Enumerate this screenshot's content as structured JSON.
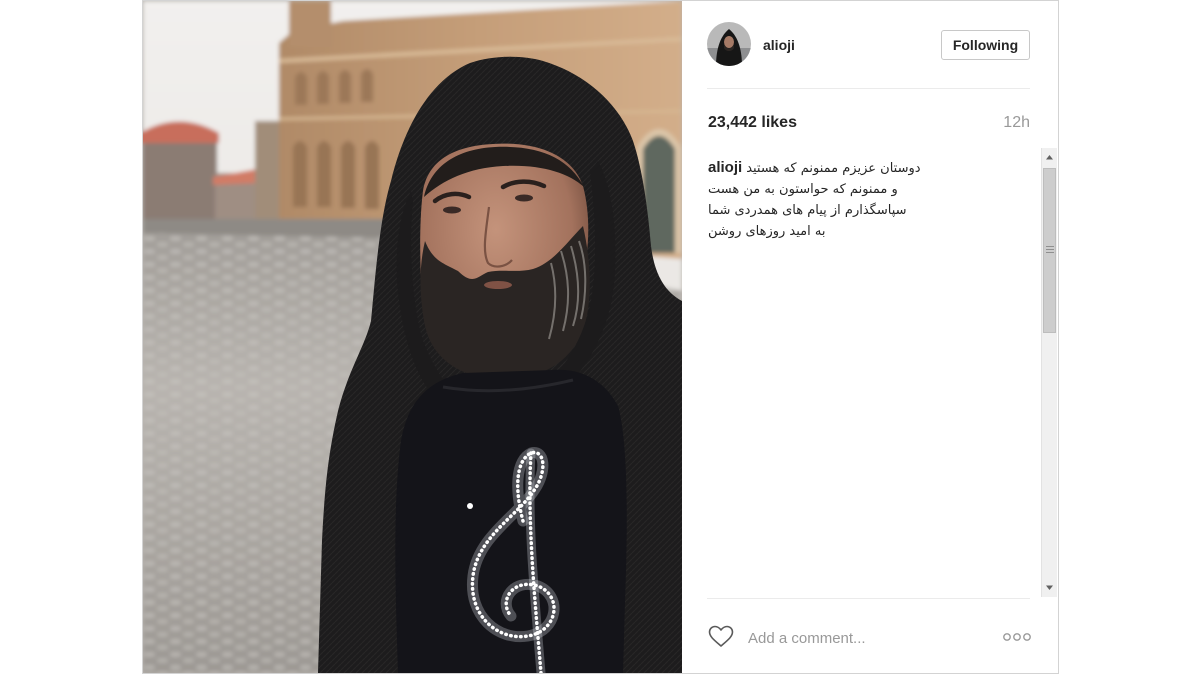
{
  "post": {
    "username": "alioji",
    "follow_button_label": "Following",
    "likes_text": "23,442 likes",
    "timestamp": "12h",
    "caption_lines": [
      "دوستان عزیزم ممنونم که هستید",
      "و ممنونم که حواستون به من هست",
      "سپاسگذارم از پیام های همدردی شما",
      "به امید روزهای روشن"
    ],
    "comment_placeholder": "Add a comment..."
  },
  "icons": {
    "like": "heart-outline-icon",
    "more": "more-options-icon",
    "scroll_up": "scroll-up-arrow-icon",
    "scroll_down": "scroll-down-arrow-icon"
  },
  "colors": {
    "text": "#262626",
    "muted_text": "#999999",
    "divider": "#ebebeb",
    "button_border": "#c8c8c8"
  }
}
